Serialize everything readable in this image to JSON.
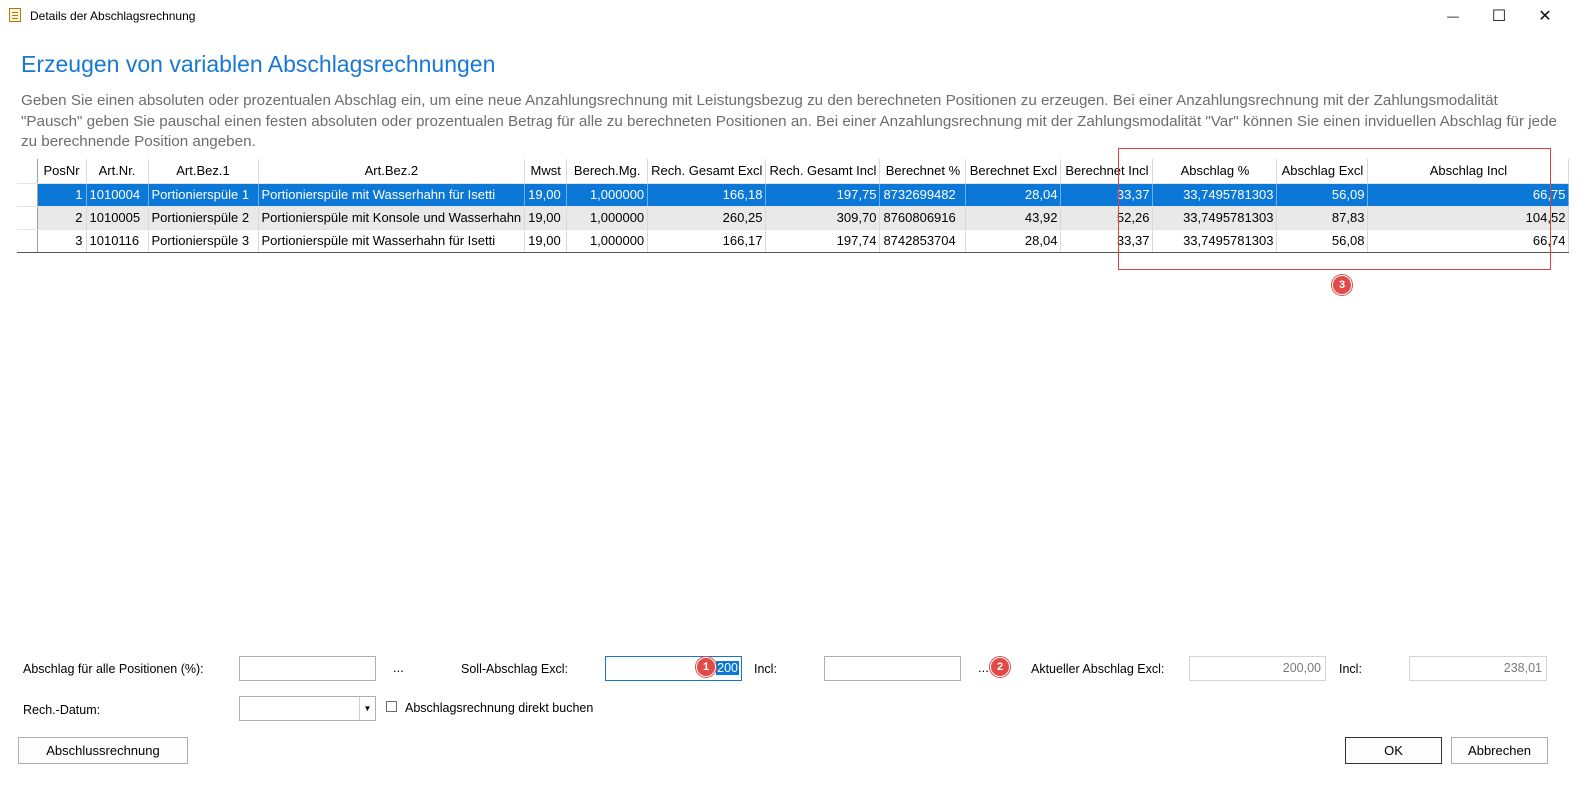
{
  "window": {
    "title": "Details der Abschlagsrechnung",
    "minimize_glyph": "—",
    "maximize_glyph": "☐",
    "close_glyph": "✕"
  },
  "heading": "Erzeugen von variablen Abschlagsrechnungen",
  "description": "Geben Sie einen absoluten oder prozentualen Abschlag ein, um eine neue Anzahlungsrechnung mit Leistungsbezug zu den berechneten Positionen zu erzeugen. Bei einer Anzahlungsrechnung mit der Zahlungsmodalität \"Pausch\" geben Sie pauschal einen festen absoluten oder prozentualen Betrag für alle zu berechneten Positionen an. Bei einer Anzahlungsrechnung mit der Zahlungsmodalität \"Var\" können Sie einen inviduellen Abschlag für jede zu berechnende Position angeben.",
  "grid": {
    "columns": [
      "PosNr",
      "Art.Nr.",
      "Art.Bez.1",
      "Art.Bez.2",
      "Mwst",
      "Berech.Mg.",
      "Rech. Gesamt Excl",
      "Rech. Gesamt Incl",
      "Berechnet %",
      "Berechnet Excl",
      "Berechnet Incl",
      "Abschlag %",
      "Abschlag Excl",
      "Abschlag Incl"
    ],
    "rows": [
      [
        "1",
        "1010004",
        "Portionierspüle 1",
        "Portionierspüle mit Wasserhahn für Isetti",
        "19,00",
        "1,000000",
        "166,18",
        "197,75",
        "8732699482",
        "28,04",
        "33,37",
        "33,7495781303",
        "56,09",
        "66,75"
      ],
      [
        "2",
        "1010005",
        "Portionierspüle 2",
        "Portionierspüle mit Konsole und Wasserhahn",
        "19,00",
        "1,000000",
        "260,25",
        "309,70",
        "8760806916",
        "43,92",
        "52,26",
        "33,7495781303",
        "87,83",
        "104,52"
      ],
      [
        "3",
        "1010116",
        "Portionierspüle 3",
        "Portionierspüle mit Wasserhahn für Isetti",
        "19,00",
        "1,000000",
        "166,17",
        "197,74",
        "8742853704",
        "28,04",
        "33,37",
        "33,7495781303",
        "56,08",
        "66,74"
      ]
    ]
  },
  "markers": {
    "m1": "1",
    "m2": "2",
    "m3": "3"
  },
  "form": {
    "abschlag_alle_label": "Abschlag für alle Positionen (%):",
    "abschlag_alle_value": "",
    "dots": "...",
    "soll_label": "Soll-Abschlag Excl:",
    "soll_value": "200",
    "incl_label": "Incl:",
    "incl_value": "",
    "aktueller_label": "Aktueller Abschlag Excl:",
    "aktueller_excl_value": "200,00",
    "aktueller_incl_label": "Incl:",
    "aktueller_incl_value": "238,01",
    "datum_label": "Rech.-Datum:",
    "datum_value": "",
    "direkt_buchen_label": "Abschlagsrechnung direkt buchen",
    "direkt_buchen_checked": false
  },
  "buttons": {
    "abschluss": "Abschlussrechnung",
    "ok": "OK",
    "abbrechen": "Abbrechen"
  }
}
